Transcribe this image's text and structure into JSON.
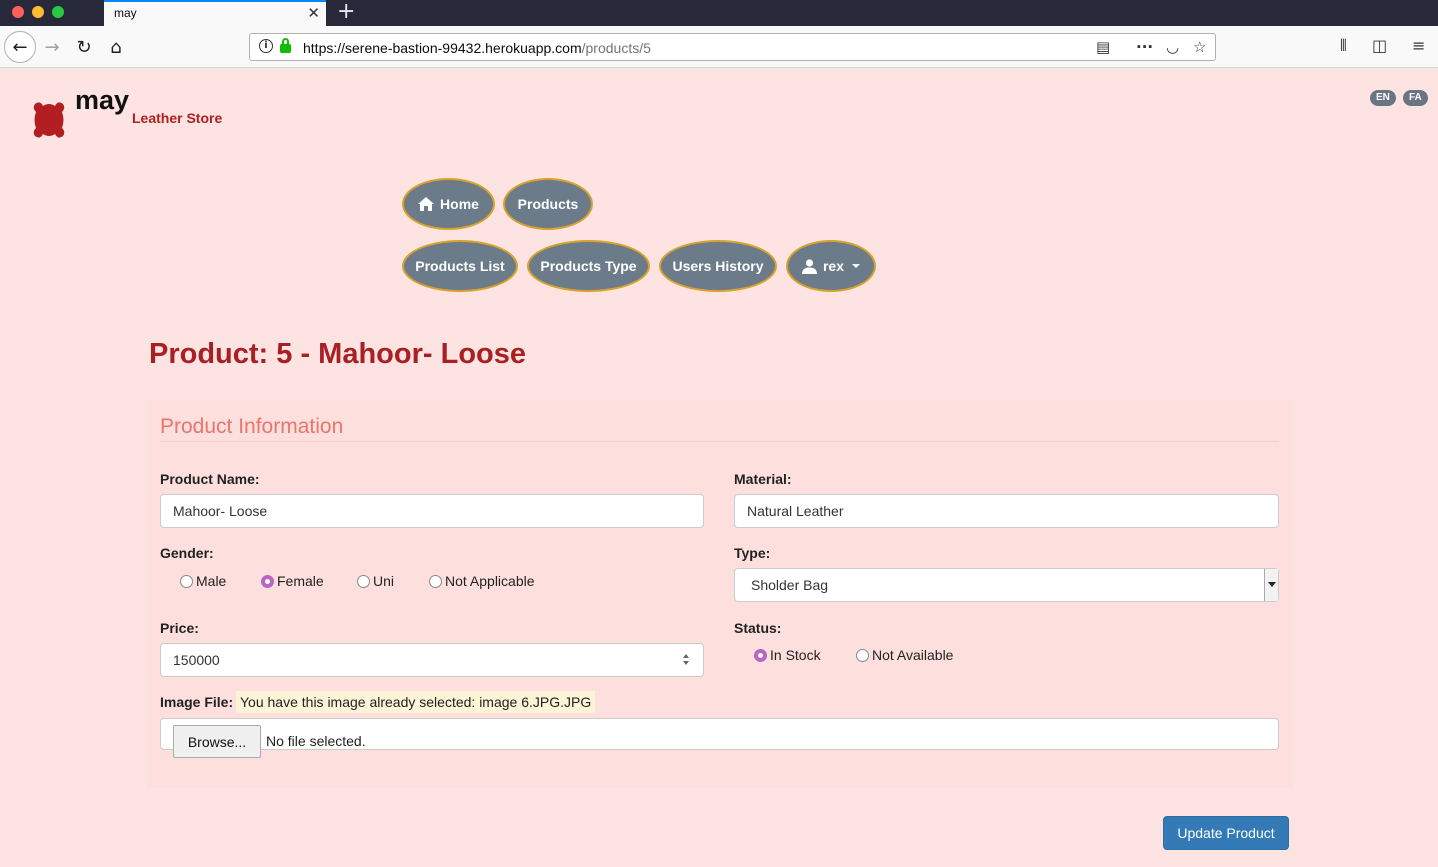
{
  "browser": {
    "tab_title": "may",
    "tab_close": "✕",
    "new_tab": "+",
    "url_main": "https://serene-bastion-99432.herokuapp.com",
    "url_path": "/products/5",
    "icons": [
      "back-icon",
      "forward-icon",
      "reload-icon",
      "home-icon",
      "info-icon",
      "lock-icon",
      "reader-icon",
      "more-icon",
      "pocket-icon",
      "star-icon",
      "library-icon",
      "sidebar-icon",
      "menu-icon"
    ]
  },
  "brand": {
    "name": "may",
    "tagline": "Leather Store",
    "color": "#b21e22"
  },
  "languages": [
    "EN",
    "FA"
  ],
  "nav": {
    "home": "Home",
    "products": "Products",
    "products_list": "Products List",
    "products_type": "Products Type",
    "users_history": "Users History",
    "user": "rex"
  },
  "page": {
    "title": "Product: 5 - Mahoor- Loose",
    "section": "Product Information"
  },
  "form": {
    "name_label": "Product Name:",
    "name_value": "Mahoor- Loose",
    "material_label": "Material:",
    "material_value": "Natural Leather",
    "gender_label": "Gender:",
    "gender_options": [
      "Male",
      "Female",
      "Uni",
      "Not Applicable"
    ],
    "gender_selected": "Female",
    "type_label": "Type:",
    "type_value": "Sholder Bag",
    "price_label": "Price:",
    "price_value": "150000",
    "status_label": "Status:",
    "status_options": [
      "In Stock",
      "Not Available"
    ],
    "status_selected": "In Stock",
    "image_label": "Image File:",
    "image_note": "You have this image already selected: image 6.JPG.JPG",
    "browse_label": "Browse...",
    "file_status": "No file selected.",
    "submit_label": "Update Product"
  },
  "colors": {
    "background": "#fde3e1",
    "nav_pill": "#6b7b89",
    "nav_border": "#d8a22c",
    "title": "#a81f24",
    "legend": "#e9756b",
    "radio_checked": "#b866c4",
    "primary_button": "#337ab7"
  }
}
